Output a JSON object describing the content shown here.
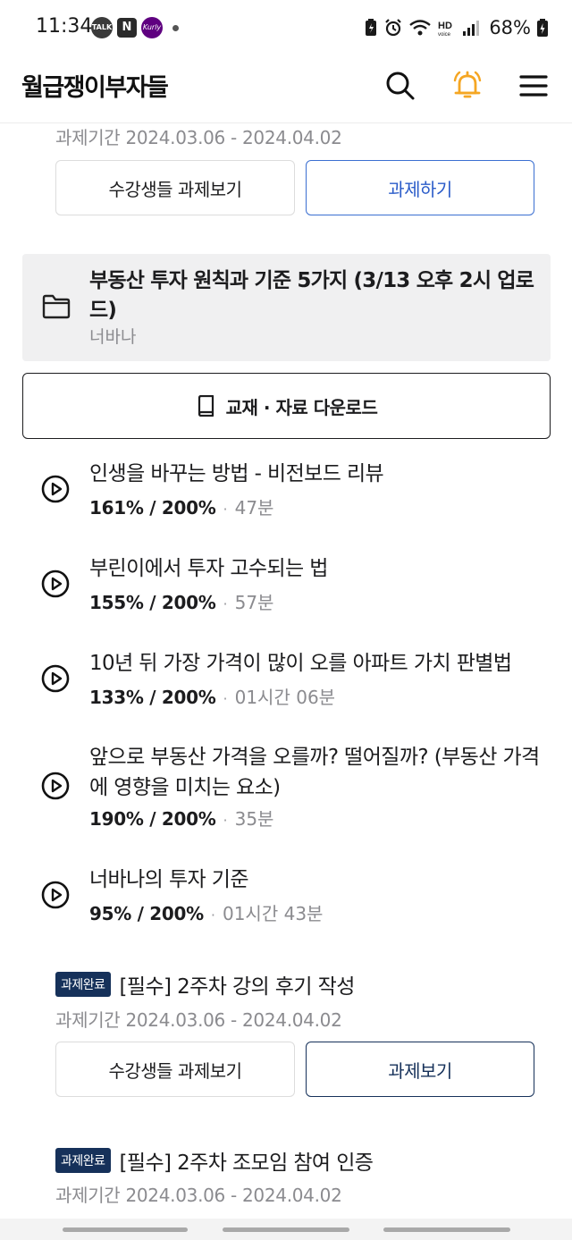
{
  "status": {
    "time": "11:34",
    "talk": "TALK",
    "naver": "N",
    "kurly": "Kurly",
    "battery": "68%"
  },
  "header": {
    "title": "월급쟁이부자들",
    "bell_color": "#f5a623"
  },
  "task_top": {
    "period": "과제기간 2024.03.06 - 2024.04.02",
    "left_button": "수강생들 과제보기",
    "right_button": "과제하기"
  },
  "folder": {
    "title": "부동산 투자 원칙과 기준 5가지 (3/13 오후 2시 업로드)",
    "author": "너바나"
  },
  "download": {
    "label": "교재 · 자료 다운로드"
  },
  "lectures": [
    {
      "title": "인생을 바꾸는 방법 - 비전보드 리뷰",
      "progress": "161% / 200%",
      "sep": "·",
      "duration": "47분"
    },
    {
      "title": "부린이에서 투자 고수되는 법",
      "progress": "155% / 200%",
      "sep": "·",
      "duration": "57분"
    },
    {
      "title": "10년 뒤 가장 가격이 많이 오를 아파트 가치 판별법",
      "progress": "133% / 200%",
      "sep": "·",
      "duration": "01시간 06분"
    },
    {
      "title": "앞으로 부동산 가격을 오를까? 떨어질까? (부동산 가격에 영향을 미치는 요소)",
      "progress": "190% / 200%",
      "sep": "·",
      "duration": "35분"
    },
    {
      "title": "너바나의 투자 기준",
      "progress": "95% / 200%",
      "sep": "·",
      "duration": "01시간 43분"
    }
  ],
  "tasks": [
    {
      "badge": "과제완료",
      "title": "[필수] 2주차 강의 후기 작성",
      "period": "과제기간 2024.03.06 - 2024.04.02",
      "left_button": "수강생들 과제보기",
      "right_button": "과제보기"
    },
    {
      "badge": "과제완료",
      "title": "[필수] 2주차 조모임 참여 인증",
      "period": "과제기간 2024.03.06 - 2024.04.02"
    }
  ]
}
